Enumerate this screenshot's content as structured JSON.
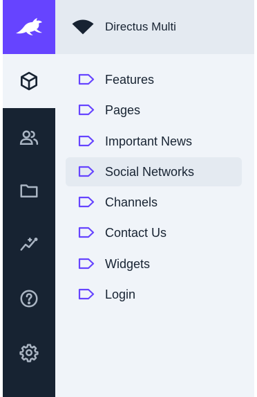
{
  "project": {
    "name": "Directus Multi"
  },
  "modules": [
    {
      "icon": "cube-icon",
      "active": true
    },
    {
      "icon": "users-icon",
      "active": false
    },
    {
      "icon": "folder-icon",
      "active": false
    },
    {
      "icon": "insights-icon",
      "active": false
    },
    {
      "icon": "help-icon",
      "active": false
    },
    {
      "icon": "settings-icon",
      "active": false
    }
  ],
  "collections": [
    {
      "label": "Features",
      "icon": "label-icon"
    },
    {
      "label": "Pages",
      "icon": "label-icon"
    },
    {
      "label": "Important News",
      "icon": "label-icon"
    },
    {
      "label": "Social Networks",
      "icon": "label-icon",
      "active": true
    },
    {
      "label": "Channels",
      "icon": "label-icon"
    },
    {
      "label": "Contact Us",
      "icon": "label-icon"
    },
    {
      "label": "Widgets",
      "icon": "label-icon"
    },
    {
      "label": "Login",
      "icon": "label-icon"
    }
  ],
  "colors": {
    "accent": "#6644ff",
    "rail": "#172332",
    "panel": "#f0f4f9",
    "header": "#e4eaf1",
    "text": "#172332"
  }
}
